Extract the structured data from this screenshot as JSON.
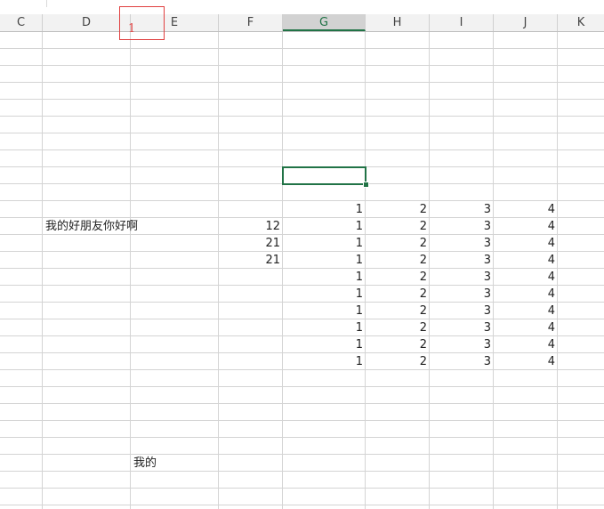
{
  "columns": [
    "C",
    "D",
    "E",
    "F",
    "G",
    "H",
    "I",
    "J",
    "K"
  ],
  "active_column": "G",
  "annotation": {
    "label": "1",
    "color": "#e04040"
  },
  "accent_color": "#217346",
  "cells": {
    "d_text": "我的好朋友你好啊",
    "e_text": "我的",
    "f_values": [
      "12",
      "21",
      "21"
    ],
    "g_values": [
      "1",
      "1",
      "1",
      "1",
      "1",
      "1",
      "1",
      "1",
      "1",
      "1"
    ],
    "h_values": [
      "2",
      "2",
      "2",
      "2",
      "2",
      "2",
      "2",
      "2",
      "2",
      "2"
    ],
    "i_values": [
      "3",
      "3",
      "3",
      "3",
      "3",
      "3",
      "3",
      "3",
      "3",
      "3"
    ],
    "j_values": [
      "4",
      "4",
      "4",
      "4",
      "4",
      "4",
      "4",
      "4",
      "4",
      "4"
    ]
  }
}
